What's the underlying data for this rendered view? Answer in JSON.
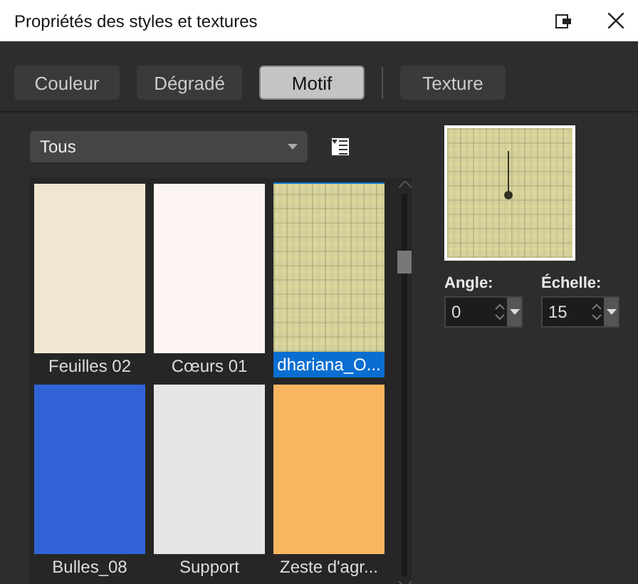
{
  "window": {
    "title": "Propriétés des styles et textures"
  },
  "tabs": [
    {
      "label": "Couleur",
      "selected": false
    },
    {
      "label": "Dégradé",
      "selected": false
    },
    {
      "label": "Motif",
      "selected": true
    },
    {
      "label": "Texture",
      "selected": false
    }
  ],
  "category_dropdown": {
    "value": "Tous"
  },
  "patterns": [
    {
      "name": "Feuilles 02",
      "kind": "plain",
      "color": "#f2e6d2",
      "selected": false
    },
    {
      "name": "Cœurs 01",
      "kind": "plain",
      "color": "#fdf5f3",
      "selected": false
    },
    {
      "name": "dhariana_O...",
      "kind": "plaid",
      "color": "#d6d3a0",
      "selected": true
    },
    {
      "name": "Bulles_08",
      "kind": "plain",
      "color": "#3163d6",
      "selected": false
    },
    {
      "name": "Support",
      "kind": "plain",
      "color": "#e6e6e6",
      "selected": false
    },
    {
      "name": "Zeste d'agr...",
      "kind": "plain",
      "color": "#fbb660",
      "selected": false
    }
  ],
  "angle": {
    "label": "Angle:",
    "value": "0"
  },
  "scale": {
    "label": "Échelle:",
    "value": "15"
  }
}
